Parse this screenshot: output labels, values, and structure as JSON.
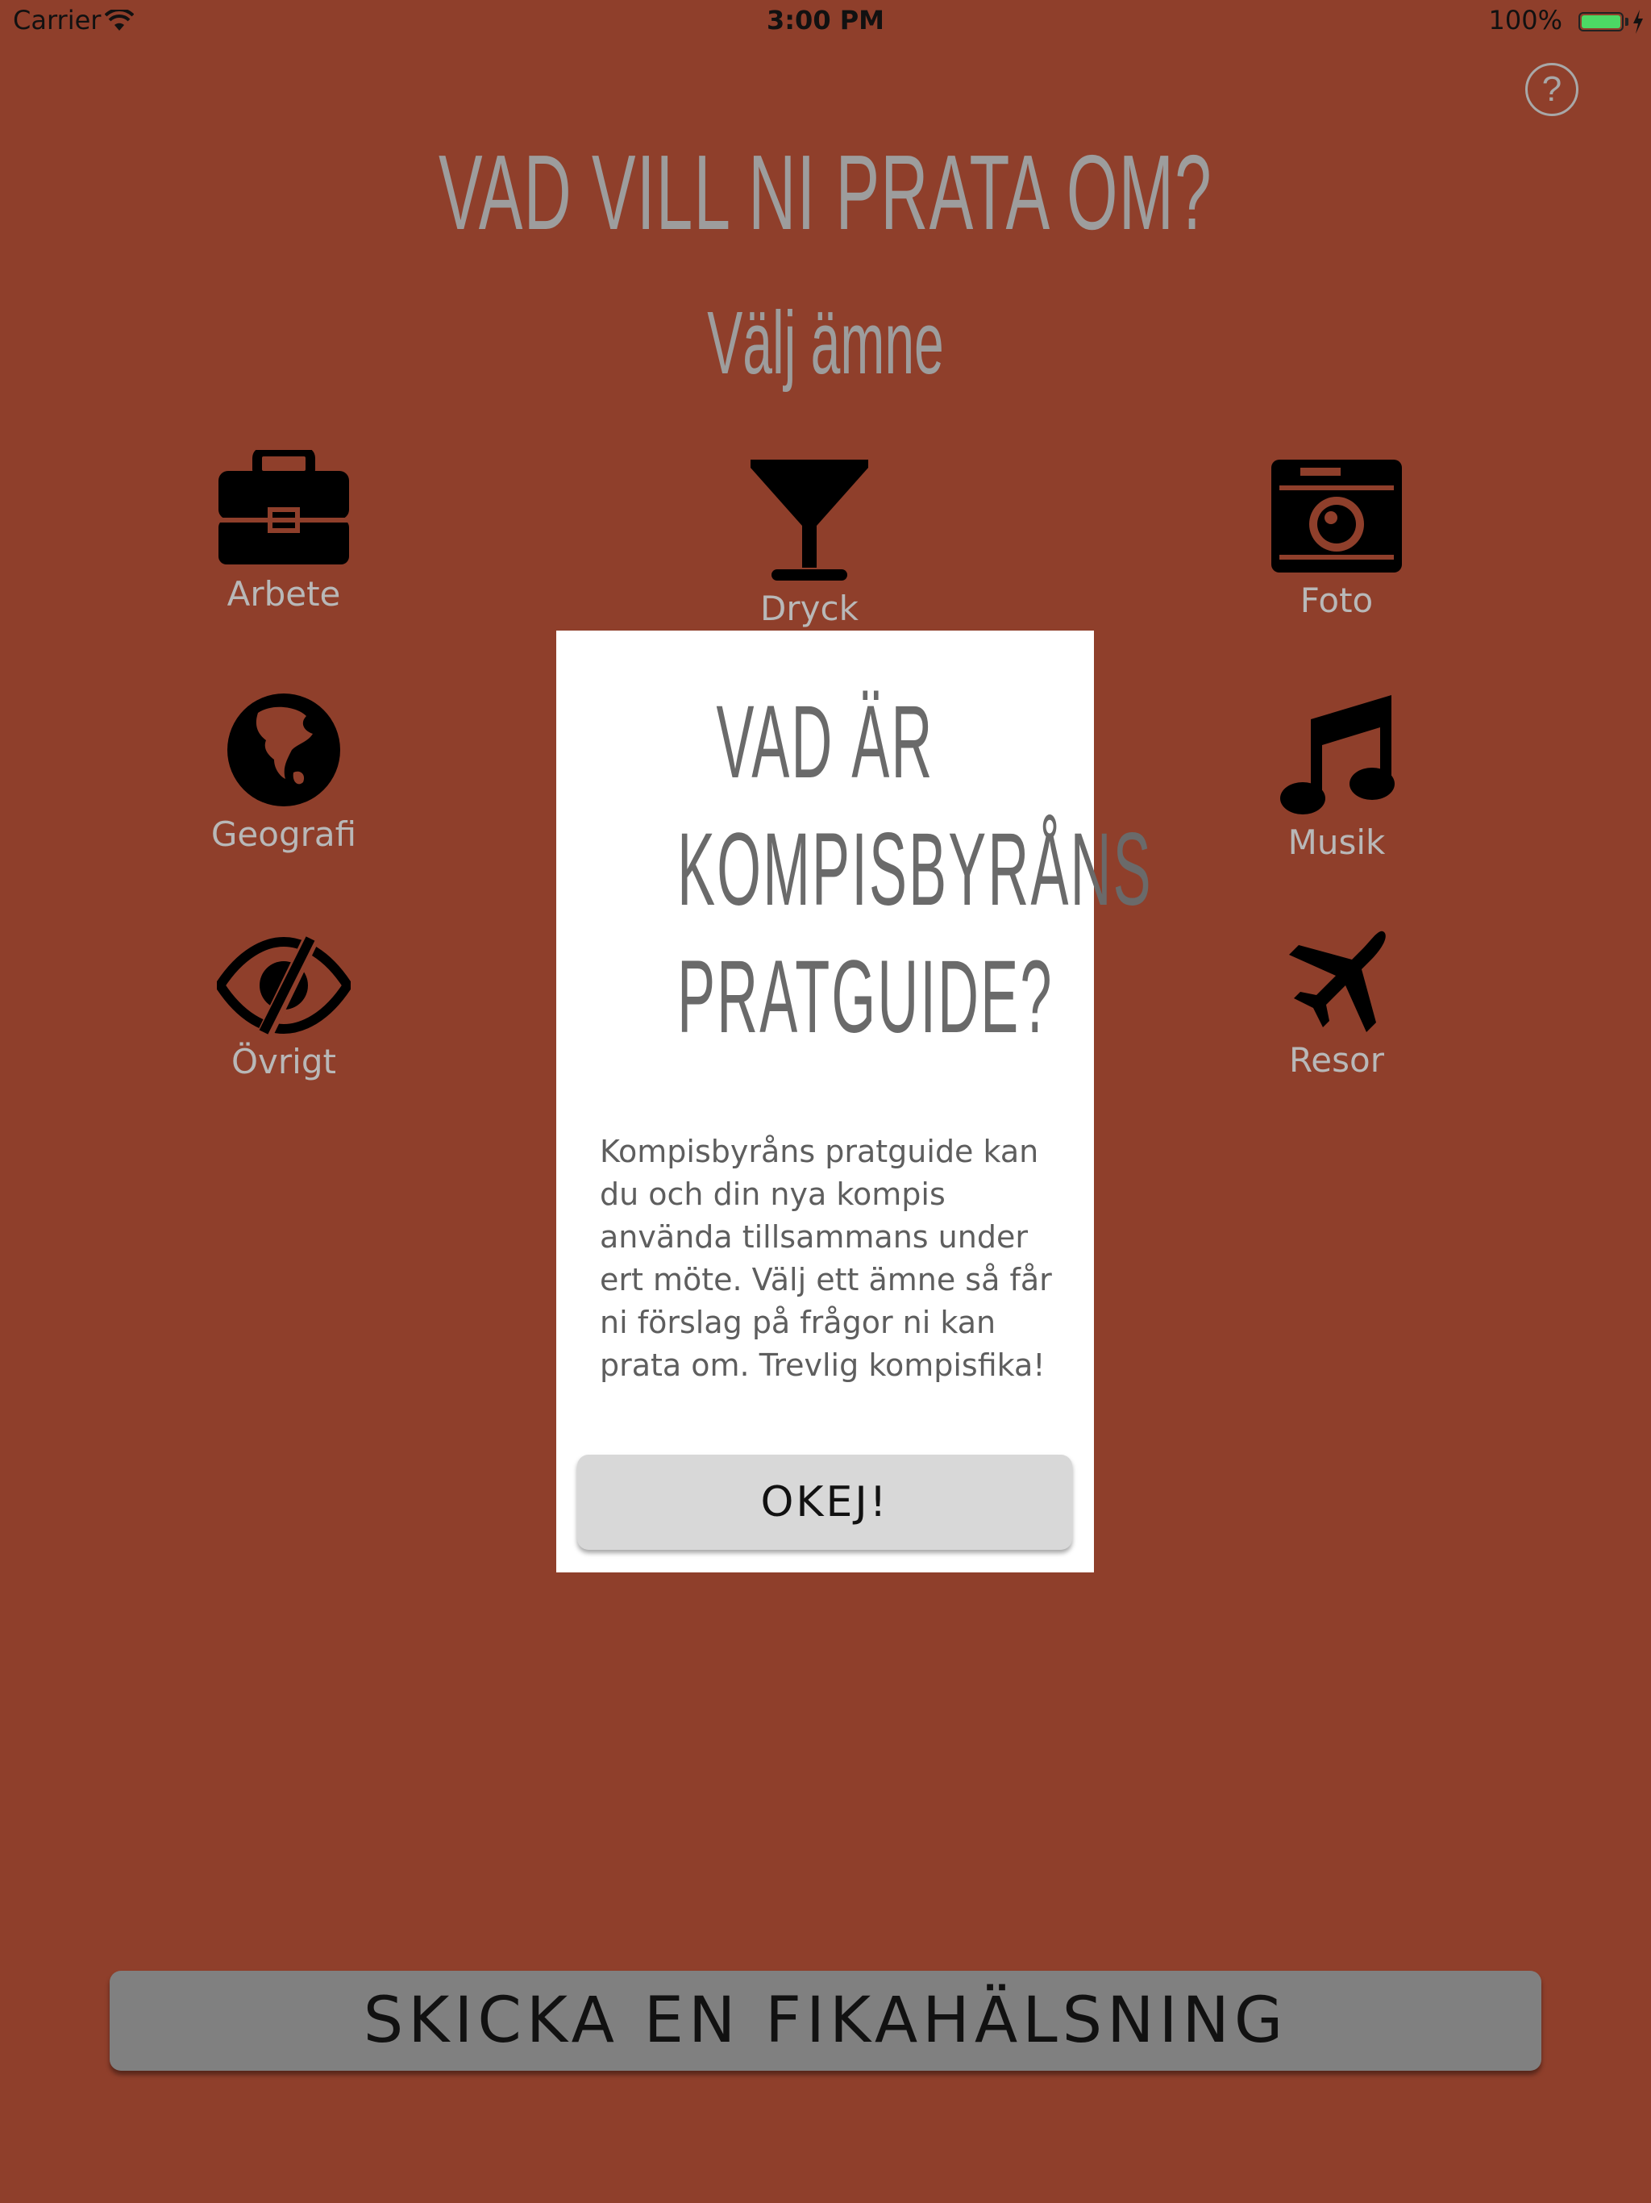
{
  "status_bar": {
    "carrier": "Carrier",
    "time": "3:00 PM",
    "battery": "100%",
    "battery_level": 1.0,
    "battery_color": "#4cd964"
  },
  "help_button": {
    "label": "?",
    "icon": "question-circle-icon"
  },
  "header": {
    "title": "VAD VILL NI PRATA OM?",
    "subtitle": "Välj ämne"
  },
  "topics": [
    {
      "label": "Arbete",
      "icon": "briefcase-icon"
    },
    {
      "label": "Dryck",
      "icon": "cocktail-glass-icon"
    },
    {
      "label": "Foto",
      "icon": "camera-icon"
    },
    {
      "label": "Geografi",
      "icon": "globe-icon"
    },
    {
      "label": "Musik",
      "icon": "music-note-icon"
    },
    {
      "label": "Övrigt",
      "icon": "eye-slash-icon"
    },
    {
      "label": "Resor",
      "icon": "airplane-icon"
    }
  ],
  "modal": {
    "title_line1": "VAD ÄR",
    "title_line2": "KOMPISBYRÅNS",
    "title_line3": "PRATGUIDE?",
    "body": "Kompisbyråns pratguide kan du och din nya kompis använda tillsammans under ert möte. Välj ett ämne så får ni förslag på frågor ni kan prata om. Trevlig kompisfika!",
    "ok_label": "OKEJ!"
  },
  "footer": {
    "fika_button_label": "SKICKA EN FIKAHÄLSNING"
  },
  "colors": {
    "background": "#8f3f2b",
    "title_text": "#9d9d9d",
    "label_text": "#b8b8b8",
    "modal_background": "#ffffff",
    "ok_button": "#d8d8d8",
    "fika_button": "#808080"
  }
}
